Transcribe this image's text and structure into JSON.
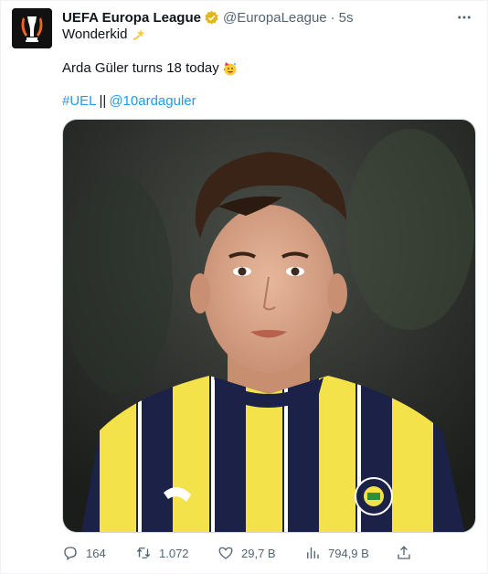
{
  "author": {
    "name": "UEFA Europa League",
    "handle": "@EuropaLeague",
    "separator": "·",
    "time": "5s",
    "avatar_icon": "uefa-europa-league-trophy-logo",
    "verified_icon": "gold-verified-badge"
  },
  "tweet": {
    "line1": "Wonderkid",
    "line1_emoji": "dizzy-emoji",
    "line2": "Arda Güler turns 18 today",
    "line2_emoji": "partying-face-emoji",
    "hashtag": "#UEL",
    "separator": "||",
    "mention": "@10ardaguler"
  },
  "media": {
    "type": "photo",
    "subject": "Player portrait in yellow and navy striped kit"
  },
  "actions": {
    "replies": "164",
    "retweets": "1.072",
    "likes": "29,7 B",
    "views": "794,9 B"
  },
  "colors": {
    "link": "#1d9bf0",
    "text": "#0f1419",
    "muted": "#536471",
    "verified_gold": "#e2b719",
    "kit_yellow": "#f3e24a",
    "kit_navy": "#1c2148"
  }
}
